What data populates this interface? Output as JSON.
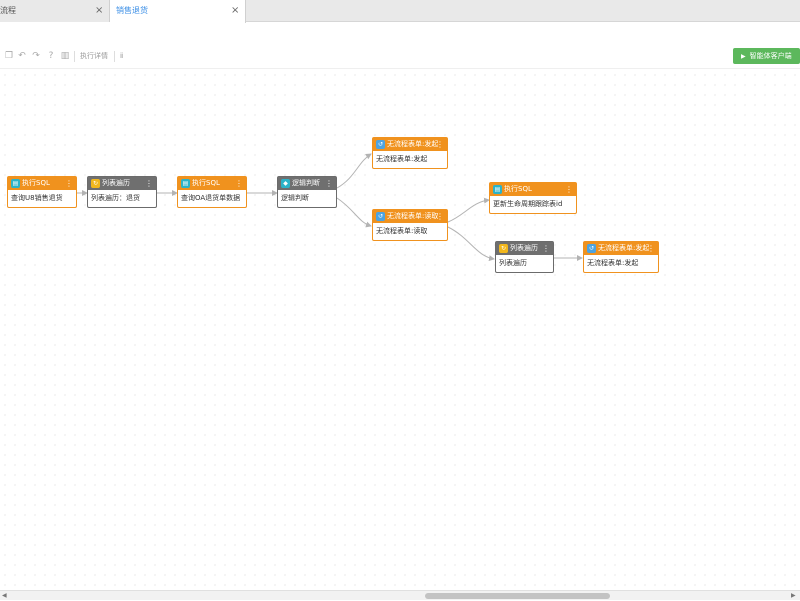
{
  "tabs": [
    {
      "label": "流程",
      "close": "×"
    },
    {
      "label": "销售退货",
      "close": "×"
    }
  ],
  "toolbar": {
    "run_detail_label": "执行详情",
    "extra_label": "ⅱ",
    "run_button_label": "智能体客户端",
    "icons": [
      "copy-icon",
      "undo-icon",
      "redo-icon",
      "help-icon",
      "delete-icon"
    ]
  },
  "nodes": [
    {
      "id": "n1",
      "title": "执行SQL",
      "body": "查询U8销售退货",
      "kind": "sql",
      "style": "orange"
    },
    {
      "id": "n2",
      "title": "列表遍历",
      "body": "列表遍历：退货",
      "kind": "loop",
      "style": "gray"
    },
    {
      "id": "n3",
      "title": "执行SQL",
      "body": "查询OA退货单数据",
      "kind": "sql",
      "style": "orange"
    },
    {
      "id": "n4",
      "title": "逻辑判断",
      "body": "逻辑判断",
      "kind": "logic",
      "style": "gray"
    },
    {
      "id": "n5",
      "title": "无流程表单:发起",
      "body": "无流程表单:发起",
      "kind": "flow",
      "style": "orange"
    },
    {
      "id": "n6",
      "title": "无流程表单:读取",
      "body": "无流程表单:读取",
      "kind": "flow",
      "style": "orange"
    },
    {
      "id": "n7",
      "title": "执行SQL",
      "body": "更新生命周期跟踪表id",
      "kind": "sql",
      "style": "orange"
    },
    {
      "id": "n8",
      "title": "列表遍历",
      "body": "列表遍历",
      "kind": "loop",
      "style": "gray"
    },
    {
      "id": "n9",
      "title": "无流程表单:发起",
      "body": "无流程表单:发起",
      "kind": "flow",
      "style": "orange"
    }
  ],
  "node_menu_glyph": "⋮",
  "colors": {
    "orange": "#f0921e",
    "gray": "#6f6f6f",
    "accent": "#3a8ee6",
    "run": "#5cb85c",
    "edge": "#b3b3b3"
  }
}
